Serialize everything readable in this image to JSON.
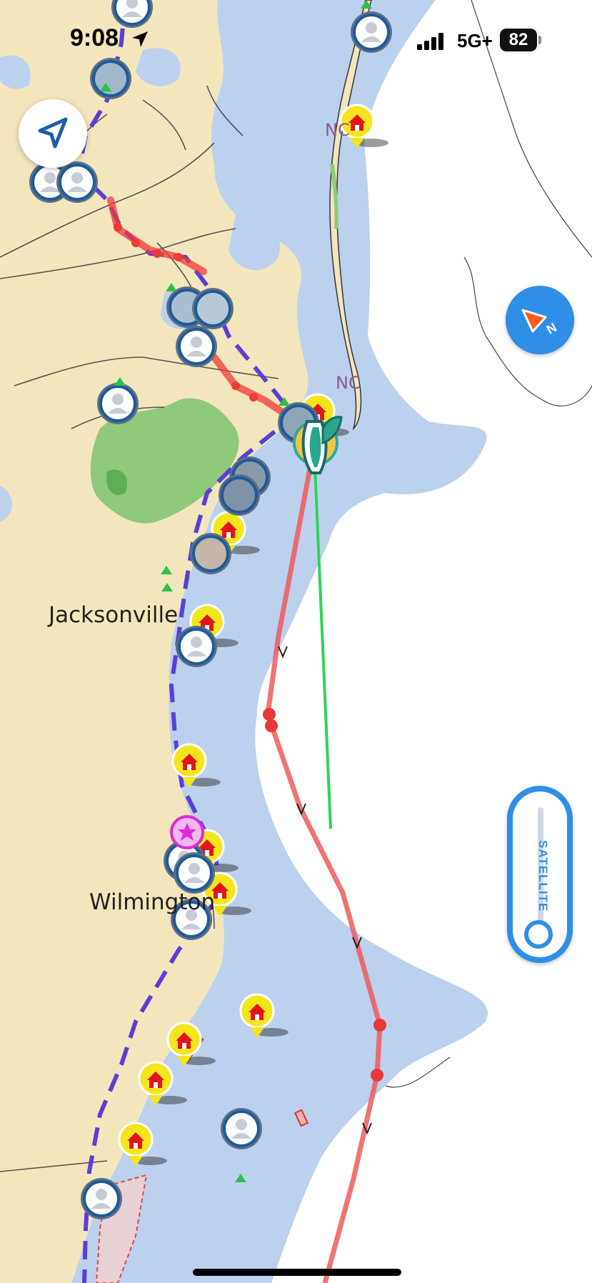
{
  "status_bar": {
    "time": "9:08",
    "network": "5G+",
    "battery": "82"
  },
  "map": {
    "city_labels": [
      "Jacksonville",
      "Wilmington"
    ],
    "region_labels": [
      "NC",
      "NC"
    ],
    "colors": {
      "land": "#f3e6bd",
      "water": "#bcd1ee",
      "park": "#8fc97a",
      "route_planned": "#ef5a5a",
      "route_track": "#5a3fd6",
      "heading_line": "#2ed35a",
      "marker_yellow": "#f5e51c",
      "marker_house": "#e2151c",
      "accent": "#2f8ee6"
    }
  },
  "controls": {
    "locate_icon": "navigation-arrow-icon",
    "compass_icon": "compass-north-icon",
    "satellite_label": "SATELLITE"
  }
}
